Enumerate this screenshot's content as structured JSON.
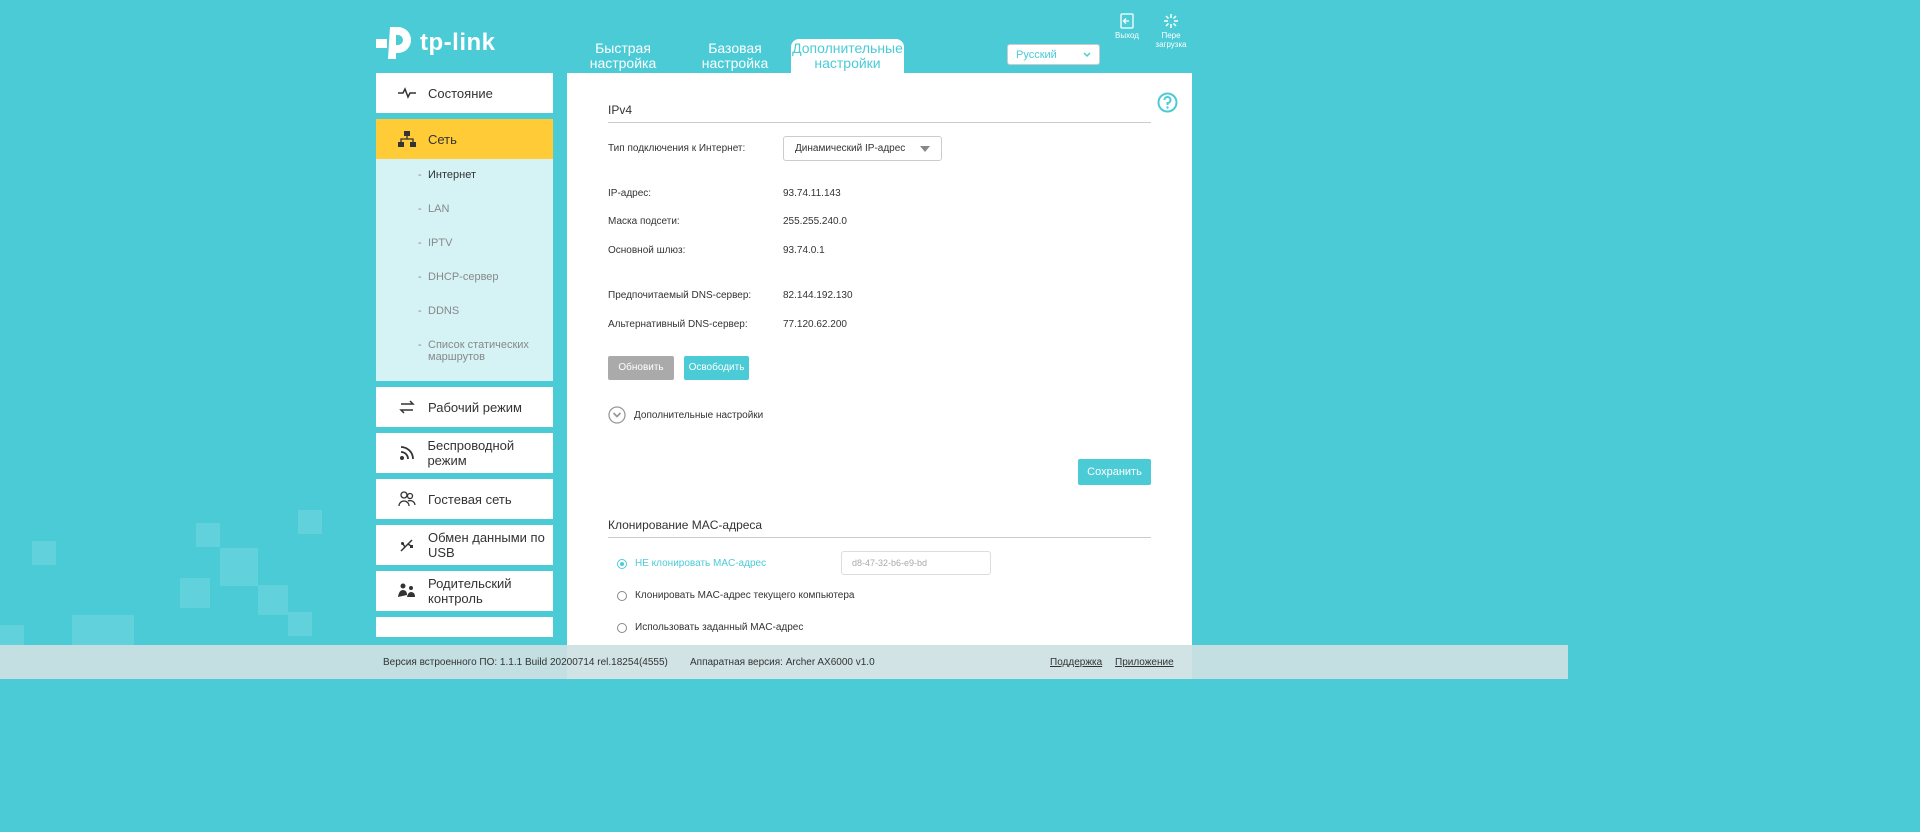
{
  "brand": {
    "logo_text": "tp-link"
  },
  "tabs": [
    {
      "label_line1": "Быстрая",
      "label_line2": "настройка"
    },
    {
      "label_line1": "Базовая",
      "label_line2": "настройка"
    },
    {
      "label_line1": "Дополнительные",
      "label_line2": "настройки"
    }
  ],
  "language": {
    "selected": "Русский"
  },
  "top_buttons": {
    "logout": "Выход",
    "reboot_line1": "Пере",
    "reboot_line2": "загрузка"
  },
  "sidebar": {
    "items": [
      {
        "label": "Состояние",
        "icon": "pulse-icon"
      },
      {
        "label": "Сеть",
        "icon": "network-icon"
      },
      {
        "label": "Рабочий режим",
        "icon": "swap-icon"
      },
      {
        "label": "Беспроводной режим",
        "icon": "wifi-icon"
      },
      {
        "label": "Гостевая сеть",
        "icon": "guests-icon"
      },
      {
        "label_line1": "Обмен данными по",
        "label_line2": "USB",
        "icon": "usb-icon"
      },
      {
        "label": "Родительский контроль",
        "icon": "parental-icon"
      }
    ],
    "subitems": [
      {
        "label": "Интернет"
      },
      {
        "label": "LAN"
      },
      {
        "label": "IPTV"
      },
      {
        "label": "DHCP-сервер"
      },
      {
        "label": "DDNS"
      },
      {
        "label_line1": "Список статических",
        "label_line2": "маршрутов"
      }
    ]
  },
  "ipv4": {
    "title": "IPv4",
    "conn_type_label": "Тип подключения к Интернет:",
    "conn_type_value": "Динамический IP-адрес",
    "ip_label": "IP-адрес:",
    "ip_value": "93.74.11.143",
    "mask_label": "Маска подсети:",
    "mask_value": "255.255.240.0",
    "gateway_label": "Основной шлюз:",
    "gateway_value": "93.74.0.1",
    "dns1_label": "Предпочитаемый DNS-сервер:",
    "dns1_value": "82.144.192.130",
    "dns2_label": "Альтернативный DNS-сервер:",
    "dns2_value": "77.120.62.200",
    "renew_button": "Обновить",
    "release_button": "Освободить",
    "advanced_label": "Дополнительные настройки",
    "save_button": "Сохранить"
  },
  "mac_clone": {
    "title": "Клонирование MAC-адреса",
    "options": [
      {
        "label": "НЕ клонировать MAC-адрес",
        "checked": true
      },
      {
        "label": "Клонировать MAC-адрес текущего компьютера",
        "checked": false
      },
      {
        "label": "Использовать заданный MAC-адрес",
        "checked": false
      }
    ],
    "mac_placeholder": "d8-47-32-b6-e9-bd"
  },
  "footer": {
    "firmware": "Версия встроенного ПО: 1.1.1 Build 20200714 rel.18254(4555)",
    "hardware": "Аппаратная версия: Archer AX6000 v1.0",
    "support": "Поддержка",
    "app": "Приложение"
  },
  "colors": {
    "accent": "#4acbd6",
    "active_nav": "#ffcb36",
    "disabled_button": "#aaaaaa"
  }
}
